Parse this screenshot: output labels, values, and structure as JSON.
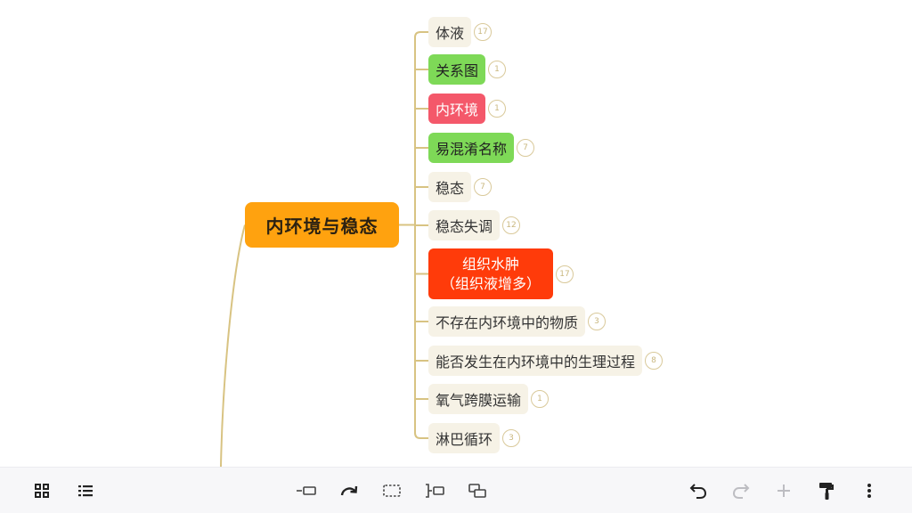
{
  "map": {
    "central": {
      "label": "内环境与稳态",
      "color": "#ffa20f"
    },
    "branch_color": "#d8c382",
    "nodes": [
      {
        "label": "体液",
        "count": "17",
        "bg": "#f6f2e6",
        "fg": "#333333"
      },
      {
        "label": "关系图",
        "count": "1",
        "bg": "#7ed957",
        "fg": "#222222"
      },
      {
        "label": "内环境",
        "count": "1",
        "bg": "#f4586a",
        "fg": "#ffffff"
      },
      {
        "label": "易混淆名称",
        "count": "7",
        "bg": "#7ed957",
        "fg": "#222222"
      },
      {
        "label": "稳态",
        "count": "7",
        "bg": "#f6f2e6",
        "fg": "#333333"
      },
      {
        "label": "稳态失调",
        "count": "12",
        "bg": "#f6f2e6",
        "fg": "#333333"
      },
      {
        "label_line1": "组织水肿",
        "label_line2": "（组织液增多）",
        "count": "17",
        "bg": "#ff3b0a",
        "fg": "#ffffff"
      },
      {
        "label": "不存在内环境中的物质",
        "count": "3",
        "bg": "#f6f2e6",
        "fg": "#333333"
      },
      {
        "label": "能否发生在内环境中的生理过程",
        "count": "8",
        "bg": "#f6f2e6",
        "fg": "#333333"
      },
      {
        "label": "氧气跨膜运输",
        "count": "1",
        "bg": "#f6f2e6",
        "fg": "#333333"
      },
      {
        "label": "淋巴循环",
        "count": "3",
        "bg": "#f6f2e6",
        "fg": "#333333"
      }
    ]
  },
  "toolbar": {
    "left": [
      "grid-view-icon",
      "outline-list-icon"
    ],
    "center": [
      "insert-sibling-topic-icon",
      "redo-arc-icon",
      "select-box-icon",
      "insert-child-topic-icon",
      "insert-parent-topic-icon"
    ],
    "right": [
      "undo-icon",
      "redo-icon",
      "add-icon",
      "format-painter-icon",
      "more-vertical-icon"
    ],
    "redo_enabled": false,
    "add_enabled": false
  }
}
